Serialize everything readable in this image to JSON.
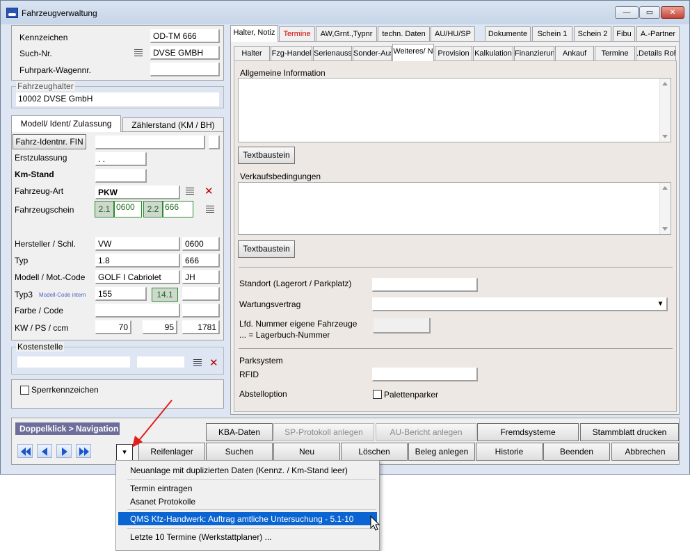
{
  "window": {
    "title": "Fahrzeugverwaltung",
    "min": "—",
    "max": "▭",
    "close": "✕"
  },
  "left": {
    "kennzeichen_label": "Kennzeichen",
    "kennzeichen_value": "OD-TM 666",
    "suchnr_label": "Such-Nr.",
    "suchnr_value": "DVSE GMBH",
    "fuhrpark_label": "Fuhrpark-Wagennr.",
    "fuhrpark_value": "",
    "halter_caption": "Fahrzeughalter",
    "halter_value": "10002 DVSE GmbH",
    "tabs": [
      "Modell/ Ident/ Zulassung",
      "Zählerstand (KM / BH)"
    ],
    "fin_button": "Fahrz-Identnr. FIN",
    "fin_value": "",
    "erstzulassung_label": "Erstzulassung",
    "erstzulassung_value": ". .",
    "kmstand_label": "Km-Stand",
    "kmstand_value": "",
    "art_label": "Fahrzeug-Art",
    "art_value": "PKW",
    "schein_label": "Fahrzeugschein",
    "schein_a": "2.1",
    "schein_a_val": "0600",
    "schein_b": "2.2",
    "schein_b_val": "666",
    "hersteller_label": "Hersteller / Schl.",
    "hersteller_value": "VW",
    "hersteller_code": "0600",
    "typ_label": "Typ",
    "typ_value": "1.8",
    "typ_code": "666",
    "modell_label": "Modell / Mot.-Code",
    "modell_value": "GOLF I Cabriolet",
    "modell_code": "JH",
    "typ3_label": "Typ3",
    "typ3_hint": "Modell-Code intern",
    "typ3_value": "155",
    "typ3_badge": "14.1",
    "farbe_label": "Farbe / Code",
    "kw_label": "KW / PS / ccm",
    "kw": "70",
    "ps": "95",
    "ccm": "1781",
    "kosten_caption": "Kostenstelle",
    "sperr_label": "Sperrkennzeichen"
  },
  "right": {
    "tabs_top": [
      "Halter, Notiz",
      "Termine",
      "AW,Grnt.,Typnr",
      "techn. Daten",
      "AU/HU/SP",
      "Dokumente",
      "Schein 1",
      "Schein 2",
      "Fibu",
      "A.-Partner"
    ],
    "tabs_sub": [
      "Halter",
      "Fzg-Handel",
      "Serienausst",
      "Sonder-Aus",
      "Weiteres/ N",
      "Provision",
      "Kalkulation",
      "Finanzierung",
      "Ankauf",
      "Termine",
      ".Details Roh"
    ],
    "allg_label": "Allgemeine Information",
    "textbaustein_1": "Textbaustein",
    "verkauf_label": "Verkaufsbedingungen",
    "textbaustein_2": "Textbaustein",
    "standort_label": "Standort (Lagerort / Parkplatz)",
    "wartung_label": "Wartungsvertrag",
    "lfd_label_1": "Lfd. Nummer eigene Fahrzeuge",
    "lfd_label_2": "... = Lagerbuch-Nummer",
    "parksystem_label": "Parksystem",
    "rfid_label": "RFID",
    "abstell_label": "Abstelloption",
    "palette_label": "Palettenparker"
  },
  "bottom": {
    "nav_label": "Doppelklick > Navigation",
    "row1": [
      "KBA-Daten",
      "SP-Protokoll anlegen",
      "AU-Bericht anlegen",
      "Fremdsysteme",
      "Stammblatt drucken"
    ],
    "row2": [
      "Reifenlager",
      "Suchen",
      "Neu",
      "Löschen",
      "Beleg anlegen",
      "Historie",
      "Beenden",
      "Abbrechen"
    ],
    "dropdown_glyph": "▾"
  },
  "menu": {
    "items": [
      "Neuanlage mit duplizierten Daten (Kennz. / Km-Stand leer)",
      "Termin eintragen",
      "Asanet Protokolle",
      "QMS Kfz-Handwerk: Auftrag amtliche Untersuchung - 5.1-10",
      "Letzte 10 Termine (Werkstattplaner) ..."
    ],
    "highlight_color": "#0a64d1"
  }
}
